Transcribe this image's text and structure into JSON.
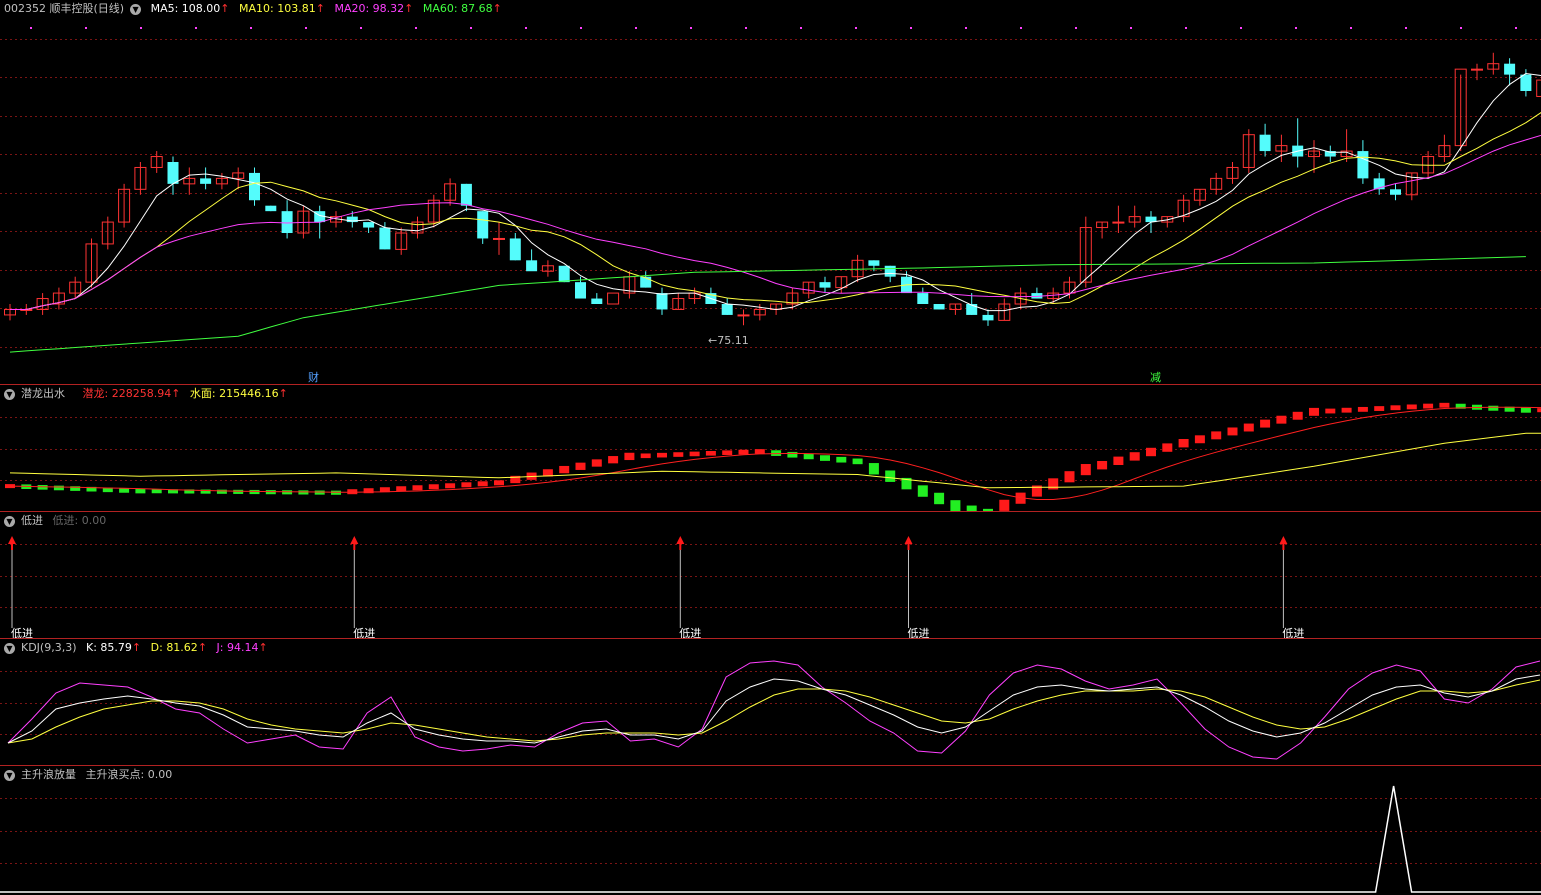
{
  "main": {
    "title": "002352 顺丰控股(日线)",
    "ma5_label": "MA5: 108.00",
    "ma10_label": "MA10: 103.81",
    "ma20_label": "MA20: 98.32",
    "ma60_label": "MA60: 87.68",
    "low_annotation": "←75.11",
    "marker_cai": "财",
    "marker_jian": "减"
  },
  "p2": {
    "name": "潜龙出水",
    "v1": "潜龙: 228258.94",
    "v2": "水面: 215446.16"
  },
  "p3": {
    "name": "低进",
    "v1": "低进: 0.00",
    "signal_label": "低进"
  },
  "p4": {
    "name": "KDJ(9,3,3)",
    "k": "K: 85.79",
    "d": "D: 81.62",
    "j": "J: 94.14"
  },
  "p5": {
    "name": "主升浪放量",
    "v1": "主升浪买点: 0.00"
  },
  "colors": {
    "up": "#ff3333",
    "down": "#54fcfc",
    "ma5": "#ffffff",
    "ma10": "#ffff40",
    "ma20": "#ff40ff",
    "ma60": "#40ff40",
    "grid": "#7a1414"
  },
  "chart_data": {
    "type": "candlestick",
    "candles": [
      [
        77,
        79,
        76,
        78
      ],
      [
        78,
        79,
        77,
        78
      ],
      [
        78,
        81,
        77,
        80
      ],
      [
        79,
        82,
        78,
        81
      ],
      [
        81,
        84,
        80,
        83
      ],
      [
        83,
        91,
        82,
        90
      ],
      [
        90,
        95,
        89,
        94
      ],
      [
        94,
        101,
        93,
        100
      ],
      [
        100,
        105,
        99,
        104
      ],
      [
        104,
        107,
        103,
        106
      ],
      [
        105,
        106,
        99,
        101
      ],
      [
        101,
        104,
        99,
        102
      ],
      [
        102,
        104,
        100,
        101
      ],
      [
        101,
        103,
        100,
        102
      ],
      [
        102,
        104,
        100,
        103
      ],
      [
        103,
        104,
        97,
        98
      ],
      [
        97,
        97,
        96,
        96
      ],
      [
        96,
        98,
        91,
        92
      ],
      [
        92,
        97,
        91,
        96
      ],
      [
        96,
        97,
        91,
        94
      ],
      [
        94,
        96,
        93,
        95
      ],
      [
        95,
        96,
        93,
        94
      ],
      [
        94,
        94,
        92,
        93
      ],
      [
        93,
        94,
        89,
        89
      ],
      [
        89,
        93,
        88,
        92
      ],
      [
        92,
        95,
        91,
        94
      ],
      [
        94,
        99,
        93,
        98
      ],
      [
        98,
        102,
        97,
        101
      ],
      [
        101,
        101,
        96,
        97
      ],
      [
        96,
        96,
        90,
        91
      ],
      [
        91,
        94,
        88,
        91
      ],
      [
        91,
        92,
        87,
        87
      ],
      [
        87,
        89,
        86,
        85
      ],
      [
        85,
        87,
        84,
        86
      ],
      [
        86,
        86,
        83,
        83
      ],
      [
        83,
        84,
        80,
        80
      ],
      [
        80,
        81,
        79,
        79
      ],
      [
        79,
        80,
        80,
        81
      ],
      [
        81,
        85,
        80,
        84
      ],
      [
        84,
        85,
        82,
        82
      ],
      [
        81,
        82,
        77,
        78
      ],
      [
        78,
        81,
        78,
        80
      ],
      [
        80,
        82,
        79,
        81
      ],
      [
        81,
        82,
        80,
        79
      ],
      [
        79,
        80,
        77,
        77
      ],
      [
        77,
        78,
        75.11,
        77
      ],
      [
        77,
        79,
        76,
        78
      ],
      [
        78,
        79,
        77,
        79
      ],
      [
        79,
        82,
        78,
        81
      ],
      [
        81,
        83,
        80,
        83
      ],
      [
        83,
        84,
        81,
        82
      ],
      [
        82,
        84,
        81,
        84
      ],
      [
        84,
        88,
        83,
        87
      ],
      [
        87,
        87,
        85,
        86
      ],
      [
        86,
        86,
        83,
        84
      ],
      [
        84,
        85,
        82,
        81
      ],
      [
        81,
        82,
        79,
        79
      ],
      [
        79,
        79,
        78,
        78
      ],
      [
        78,
        79,
        77,
        79
      ],
      [
        79,
        81,
        77,
        77
      ],
      [
        77,
        78,
        75,
        76
      ],
      [
        76,
        80,
        76,
        79
      ],
      [
        79,
        82,
        78,
        81
      ],
      [
        81,
        82,
        80,
        80
      ],
      [
        80,
        82,
        79,
        81
      ],
      [
        81,
        84,
        80,
        83
      ],
      [
        83,
        95,
        82,
        93
      ],
      [
        93,
        94,
        91,
        94
      ],
      [
        94,
        97,
        92,
        94
      ],
      [
        94,
        97,
        93,
        95
      ],
      [
        95,
        96,
        92,
        94
      ],
      [
        94,
        95,
        93,
        95
      ],
      [
        95,
        99,
        94,
        98
      ],
      [
        98,
        100,
        97,
        100
      ],
      [
        100,
        103,
        99,
        102
      ],
      [
        102,
        105,
        101,
        104
      ],
      [
        104,
        111,
        103,
        110
      ],
      [
        110,
        112,
        106,
        107
      ],
      [
        107,
        110,
        105,
        108
      ],
      [
        108,
        113,
        104,
        106
      ],
      [
        106,
        109,
        103,
        107
      ],
      [
        107,
        108,
        105,
        106
      ],
      [
        106,
        111,
        105,
        107
      ],
      [
        107,
        109,
        101,
        102
      ],
      [
        102,
        103,
        99,
        100
      ],
      [
        100,
        101,
        98,
        99
      ],
      [
        99,
        103,
        98,
        103
      ],
      [
        103,
        107,
        102,
        106
      ],
      [
        106,
        110,
        105,
        108
      ],
      [
        108,
        121,
        107,
        122
      ],
      [
        122,
        123,
        120,
        122
      ],
      [
        122,
        125,
        121,
        123
      ],
      [
        123,
        124,
        119,
        121
      ],
      [
        121,
        122,
        117,
        118
      ],
      [
        117,
        120,
        116,
        120
      ],
      [
        120,
        123,
        118,
        126
      ]
    ],
    "ma60_segments": [
      [
        0,
        70.2
      ],
      [
        14,
        73.1
      ],
      [
        18,
        76.5
      ],
      [
        30,
        82.4
      ],
      [
        42,
        84.8
      ],
      [
        56,
        85.6
      ],
      [
        64,
        86.2
      ],
      [
        80,
        86.5
      ],
      [
        93,
        87.68
      ]
    ],
    "kdj": {
      "k": [
        18,
        30,
        52,
        58,
        62,
        65,
        62,
        58,
        55,
        46,
        34,
        32,
        30,
        26,
        24,
        38,
        48,
        32,
        26,
        22,
        20,
        20,
        18,
        24,
        30,
        32,
        26,
        26,
        22,
        30,
        60,
        74,
        82,
        80,
        72,
        66,
        56,
        46,
        34,
        28,
        34,
        50,
        66,
        74,
        76,
        72,
        70,
        72,
        74,
        66,
        54,
        40,
        30,
        24,
        28,
        38,
        52,
        66,
        74,
        76,
        68,
        64,
        70,
        82,
        86
      ],
      "d": [
        18,
        22,
        34,
        44,
        52,
        56,
        60,
        60,
        58,
        52,
        42,
        36,
        32,
        30,
        28,
        32,
        38,
        36,
        32,
        28,
        24,
        22,
        20,
        22,
        26,
        28,
        28,
        28,
        26,
        28,
        40,
        54,
        66,
        72,
        72,
        70,
        64,
        56,
        48,
        40,
        38,
        42,
        52,
        60,
        66,
        70,
        70,
        70,
        72,
        70,
        64,
        54,
        44,
        36,
        32,
        34,
        42,
        52,
        62,
        70,
        70,
        68,
        70,
        76,
        81
      ],
      "j": [
        18,
        42,
        68,
        78,
        76,
        74,
        64,
        52,
        48,
        32,
        18,
        22,
        26,
        14,
        12,
        48,
        64,
        24,
        14,
        10,
        12,
        16,
        14,
        28,
        38,
        40,
        20,
        22,
        14,
        32,
        84,
        98,
        100,
        96,
        74,
        58,
        40,
        28,
        10,
        8,
        30,
        66,
        88,
        96,
        92,
        80,
        72,
        76,
        82,
        58,
        32,
        14,
        4,
        2,
        18,
        44,
        72,
        88,
        96,
        90,
        62,
        58,
        72,
        94,
        100
      ]
    },
    "qianlong": {
      "x": [
        0,
        8,
        20,
        30,
        38,
        46,
        52,
        58,
        60,
        66,
        72,
        80,
        88,
        93
      ],
      "values": [
        -70,
        -85,
        -90,
        -60,
        20,
        35,
        5,
        -130,
        -150,
        -20,
        60,
        155,
        175,
        160
      ]
    },
    "shuimian": {
      "x": [
        0,
        8,
        20,
        30,
        40,
        52,
        56,
        60,
        72,
        80,
        88,
        93
      ],
      "values": [
        -30,
        -40,
        -30,
        -45,
        -25,
        -35,
        -55,
        -75,
        -70,
        -10,
        60,
        90
      ]
    },
    "dijin_signals": [
      0,
      21,
      41,
      55,
      78
    ],
    "zhushenglang_spike": {
      "x": 82,
      "value": 1
    }
  }
}
